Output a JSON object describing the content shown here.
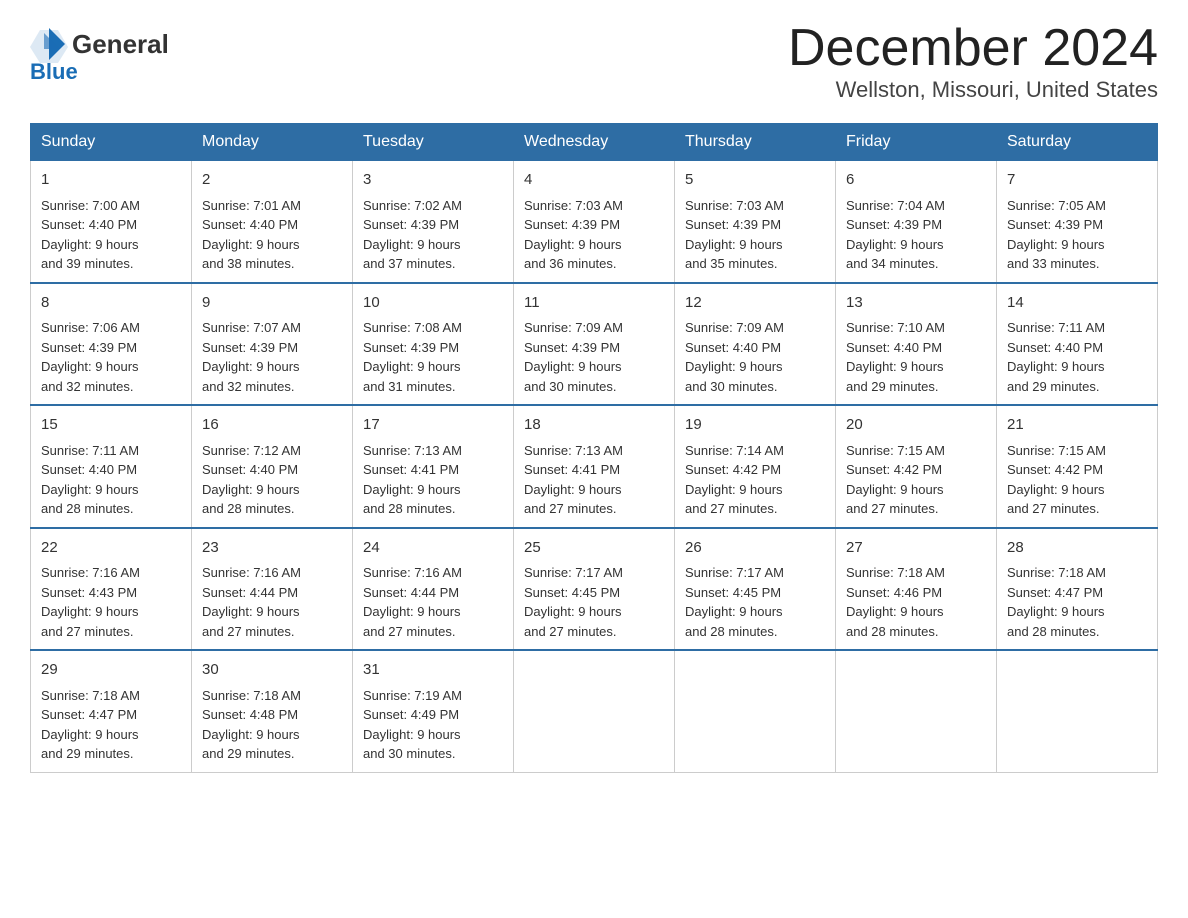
{
  "header": {
    "logo_general": "General",
    "logo_blue": "Blue",
    "month_title": "December 2024",
    "location": "Wellston, Missouri, United States"
  },
  "days_of_week": [
    "Sunday",
    "Monday",
    "Tuesday",
    "Wednesday",
    "Thursday",
    "Friday",
    "Saturday"
  ],
  "weeks": [
    [
      {
        "day": "1",
        "sunrise": "7:00 AM",
        "sunset": "4:40 PM",
        "daylight": "9 hours and 39 minutes."
      },
      {
        "day": "2",
        "sunrise": "7:01 AM",
        "sunset": "4:40 PM",
        "daylight": "9 hours and 38 minutes."
      },
      {
        "day": "3",
        "sunrise": "7:02 AM",
        "sunset": "4:39 PM",
        "daylight": "9 hours and 37 minutes."
      },
      {
        "day": "4",
        "sunrise": "7:03 AM",
        "sunset": "4:39 PM",
        "daylight": "9 hours and 36 minutes."
      },
      {
        "day": "5",
        "sunrise": "7:03 AM",
        "sunset": "4:39 PM",
        "daylight": "9 hours and 35 minutes."
      },
      {
        "day": "6",
        "sunrise": "7:04 AM",
        "sunset": "4:39 PM",
        "daylight": "9 hours and 34 minutes."
      },
      {
        "day": "7",
        "sunrise": "7:05 AM",
        "sunset": "4:39 PM",
        "daylight": "9 hours and 33 minutes."
      }
    ],
    [
      {
        "day": "8",
        "sunrise": "7:06 AM",
        "sunset": "4:39 PM",
        "daylight": "9 hours and 32 minutes."
      },
      {
        "day": "9",
        "sunrise": "7:07 AM",
        "sunset": "4:39 PM",
        "daylight": "9 hours and 32 minutes."
      },
      {
        "day": "10",
        "sunrise": "7:08 AM",
        "sunset": "4:39 PM",
        "daylight": "9 hours and 31 minutes."
      },
      {
        "day": "11",
        "sunrise": "7:09 AM",
        "sunset": "4:39 PM",
        "daylight": "9 hours and 30 minutes."
      },
      {
        "day": "12",
        "sunrise": "7:09 AM",
        "sunset": "4:40 PM",
        "daylight": "9 hours and 30 minutes."
      },
      {
        "day": "13",
        "sunrise": "7:10 AM",
        "sunset": "4:40 PM",
        "daylight": "9 hours and 29 minutes."
      },
      {
        "day": "14",
        "sunrise": "7:11 AM",
        "sunset": "4:40 PM",
        "daylight": "9 hours and 29 minutes."
      }
    ],
    [
      {
        "day": "15",
        "sunrise": "7:11 AM",
        "sunset": "4:40 PM",
        "daylight": "9 hours and 28 minutes."
      },
      {
        "day": "16",
        "sunrise": "7:12 AM",
        "sunset": "4:40 PM",
        "daylight": "9 hours and 28 minutes."
      },
      {
        "day": "17",
        "sunrise": "7:13 AM",
        "sunset": "4:41 PM",
        "daylight": "9 hours and 28 minutes."
      },
      {
        "day": "18",
        "sunrise": "7:13 AM",
        "sunset": "4:41 PM",
        "daylight": "9 hours and 27 minutes."
      },
      {
        "day": "19",
        "sunrise": "7:14 AM",
        "sunset": "4:42 PM",
        "daylight": "9 hours and 27 minutes."
      },
      {
        "day": "20",
        "sunrise": "7:15 AM",
        "sunset": "4:42 PM",
        "daylight": "9 hours and 27 minutes."
      },
      {
        "day": "21",
        "sunrise": "7:15 AM",
        "sunset": "4:42 PM",
        "daylight": "9 hours and 27 minutes."
      }
    ],
    [
      {
        "day": "22",
        "sunrise": "7:16 AM",
        "sunset": "4:43 PM",
        "daylight": "9 hours and 27 minutes."
      },
      {
        "day": "23",
        "sunrise": "7:16 AM",
        "sunset": "4:44 PM",
        "daylight": "9 hours and 27 minutes."
      },
      {
        "day": "24",
        "sunrise": "7:16 AM",
        "sunset": "4:44 PM",
        "daylight": "9 hours and 27 minutes."
      },
      {
        "day": "25",
        "sunrise": "7:17 AM",
        "sunset": "4:45 PM",
        "daylight": "9 hours and 27 minutes."
      },
      {
        "day": "26",
        "sunrise": "7:17 AM",
        "sunset": "4:45 PM",
        "daylight": "9 hours and 28 minutes."
      },
      {
        "day": "27",
        "sunrise": "7:18 AM",
        "sunset": "4:46 PM",
        "daylight": "9 hours and 28 minutes."
      },
      {
        "day": "28",
        "sunrise": "7:18 AM",
        "sunset": "4:47 PM",
        "daylight": "9 hours and 28 minutes."
      }
    ],
    [
      {
        "day": "29",
        "sunrise": "7:18 AM",
        "sunset": "4:47 PM",
        "daylight": "9 hours and 29 minutes."
      },
      {
        "day": "30",
        "sunrise": "7:18 AM",
        "sunset": "4:48 PM",
        "daylight": "9 hours and 29 minutes."
      },
      {
        "day": "31",
        "sunrise": "7:19 AM",
        "sunset": "4:49 PM",
        "daylight": "9 hours and 30 minutes."
      },
      null,
      null,
      null,
      null
    ]
  ],
  "labels": {
    "sunrise": "Sunrise:",
    "sunset": "Sunset:",
    "daylight": "Daylight:"
  }
}
